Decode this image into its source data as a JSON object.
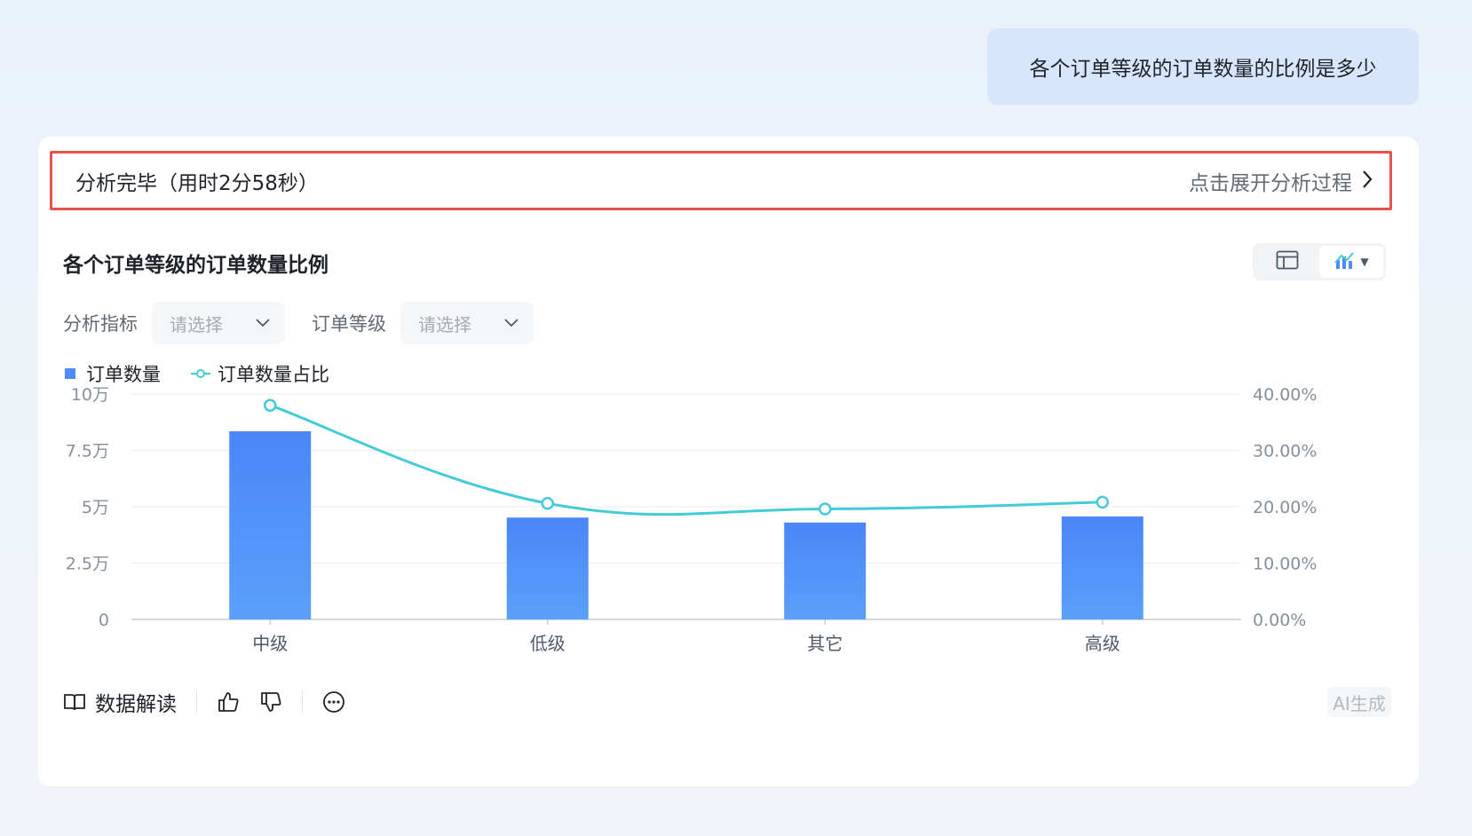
{
  "question": "各个订单等级的订单数量的比例是多少",
  "analysis": {
    "status": "分析完毕（用时2分58秒）",
    "expand_label": "点击展开分析过程"
  },
  "chart_title": "各个订单等级的订单数量比例",
  "view_switch": {
    "options": [
      "table-icon",
      "chart-icon"
    ],
    "active": "chart-icon"
  },
  "filters": [
    {
      "label": "分析指标",
      "placeholder": "请选择"
    },
    {
      "label": "订单等级",
      "placeholder": "请选择"
    }
  ],
  "legend": {
    "bar": "订单数量",
    "line": "订单数量占比"
  },
  "footer": {
    "read_label": "数据解读",
    "ai_tag": "AI生成"
  },
  "colors": {
    "bar_top": "#4a86f7",
    "bar_bottom": "#5aa0fb",
    "line": "#45cbd7",
    "highlight_border": "#e5534b"
  },
  "chart_data": {
    "type": "bar",
    "categories": [
      "中级",
      "低级",
      "其它",
      "高级"
    ],
    "series": [
      {
        "name": "订单数量",
        "type": "bar",
        "axis": "left",
        "values": [
          83500,
          45200,
          43000,
          45700
        ]
      },
      {
        "name": "订单数量占比",
        "type": "line",
        "axis": "right",
        "values": [
          38.0,
          20.6,
          19.6,
          20.8
        ]
      }
    ],
    "y_left": {
      "ticks": [
        "0",
        "2.5万",
        "5万",
        "7.5万",
        "10万"
      ],
      "ylim": [
        0,
        100000
      ]
    },
    "y_right": {
      "ticks": [
        "0.00%",
        "10.00%",
        "20.00%",
        "30.00%",
        "40.00%"
      ],
      "ylim": [
        0,
        40
      ]
    },
    "grid": true,
    "legend_position": "top-left"
  }
}
